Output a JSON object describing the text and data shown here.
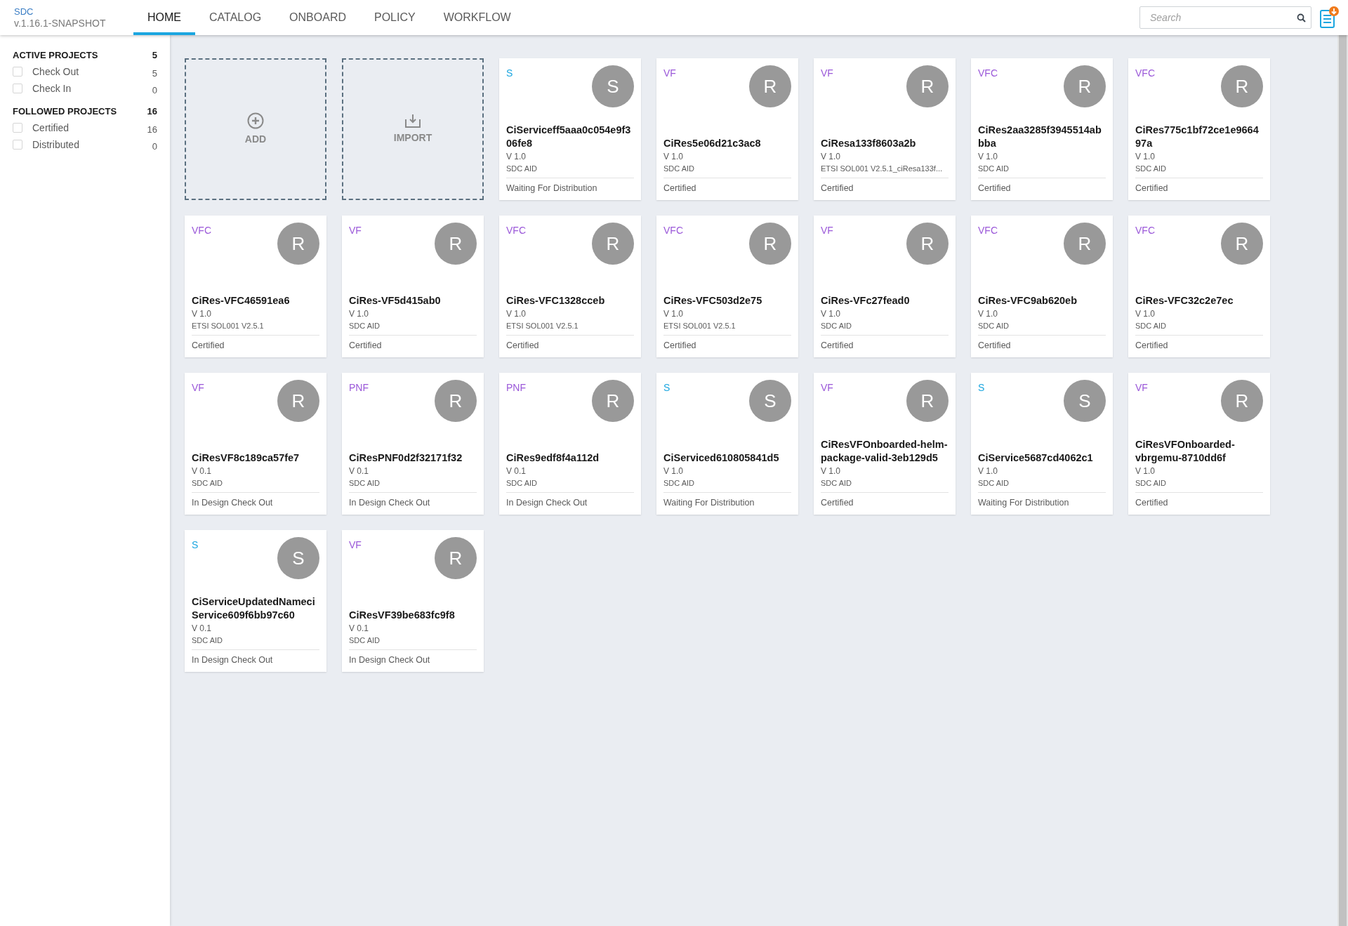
{
  "app": {
    "name": "SDC",
    "version": "v.1.16.1-SNAPSHOT"
  },
  "tabs": [
    {
      "label": "HOME",
      "selected": true
    },
    {
      "label": "CATALOG",
      "selected": false
    },
    {
      "label": "ONBOARD",
      "selected": false
    },
    {
      "label": "POLICY",
      "selected": false
    },
    {
      "label": "WORKFLOW",
      "selected": false
    }
  ],
  "search": {
    "placeholder": "Search"
  },
  "sidebar": {
    "sections": [
      {
        "title": "ACTIVE PROJECTS",
        "count": "5",
        "items": [
          {
            "label": "Check Out",
            "count": "5",
            "checked": false
          },
          {
            "label": "Check In",
            "count": "0",
            "checked": false
          }
        ]
      },
      {
        "title": "FOLLOWED PROJECTS",
        "count": "16",
        "items": [
          {
            "label": "Certified",
            "count": "16",
            "checked": false
          },
          {
            "label": "Distributed",
            "count": "0",
            "checked": false
          }
        ]
      }
    ]
  },
  "actions": [
    {
      "kind": "add",
      "label": "ADD"
    },
    {
      "kind": "import",
      "label": "IMPORT"
    }
  ],
  "cards": [
    {
      "type": "S",
      "color": "#1ba6e0",
      "avatar": "S",
      "name": "CiServiceff5aaa0c054e9f306fe8",
      "version": "V 1.0",
      "vendor": "SDC AID",
      "status": "Waiting For Distribution"
    },
    {
      "type": "VF",
      "color": "#9b59d9",
      "avatar": "R",
      "name": "CiRes5e06d21c3ac8",
      "version": "V 1.0",
      "vendor": "SDC AID",
      "status": "Certified"
    },
    {
      "type": "VF",
      "color": "#9b59d9",
      "avatar": "R",
      "name": "CiResa133f8603a2b",
      "version": "V 1.0",
      "vendor": "ETSI SOL001 V2.5.1_ciResa133f...",
      "status": "Certified"
    },
    {
      "type": "VFC",
      "color": "#9b59d9",
      "avatar": "R",
      "name": "CiRes2aa3285f3945514abbba",
      "version": "V 1.0",
      "vendor": "SDC AID",
      "status": "Certified"
    },
    {
      "type": "VFC",
      "color": "#9b59d9",
      "avatar": "R",
      "name": "CiRes775c1bf72ce1e966497a",
      "version": "V 1.0",
      "vendor": "SDC AID",
      "status": "Certified"
    },
    {
      "type": "VFC",
      "color": "#9b59d9",
      "avatar": "R",
      "name": "CiRes-VFC46591ea6",
      "version": "V 1.0",
      "vendor": "ETSI SOL001 V2.5.1",
      "status": "Certified"
    },
    {
      "type": "VF",
      "color": "#9b59d9",
      "avatar": "R",
      "name": "CiRes-VF5d415ab0",
      "version": "V 1.0",
      "vendor": "SDC AID",
      "status": "Certified"
    },
    {
      "type": "VFC",
      "color": "#9b59d9",
      "avatar": "R",
      "name": "CiRes-VFC1328cceb",
      "version": "V 1.0",
      "vendor": "ETSI SOL001 V2.5.1",
      "status": "Certified"
    },
    {
      "type": "VFC",
      "color": "#9b59d9",
      "avatar": "R",
      "name": "CiRes-VFC503d2e75",
      "version": "V 1.0",
      "vendor": "ETSI SOL001 V2.5.1",
      "status": "Certified"
    },
    {
      "type": "VF",
      "color": "#9b59d9",
      "avatar": "R",
      "name": "CiRes-VFc27fead0",
      "version": "V 1.0",
      "vendor": "SDC AID",
      "status": "Certified"
    },
    {
      "type": "VFC",
      "color": "#9b59d9",
      "avatar": "R",
      "name": "CiRes-VFC9ab620eb",
      "version": "V 1.0",
      "vendor": "SDC AID",
      "status": "Certified"
    },
    {
      "type": "VFC",
      "color": "#9b59d9",
      "avatar": "R",
      "name": "CiRes-VFC32c2e7ec",
      "version": "V 1.0",
      "vendor": "SDC AID",
      "status": "Certified"
    },
    {
      "type": "VF",
      "color": "#9b59d9",
      "avatar": "R",
      "name": "CiResVF8c189ca57fe7",
      "version": "V 0.1",
      "vendor": "SDC AID",
      "status": "In Design Check Out"
    },
    {
      "type": "PNF",
      "color": "#9b59d9",
      "avatar": "R",
      "name": "CiResPNF0d2f32171f32",
      "version": "V 0.1",
      "vendor": "SDC AID",
      "status": "In Design Check Out"
    },
    {
      "type": "PNF",
      "color": "#9b59d9",
      "avatar": "R",
      "name": "CiRes9edf8f4a112d",
      "version": "V 0.1",
      "vendor": "SDC AID",
      "status": "In Design Check Out"
    },
    {
      "type": "S",
      "color": "#1ba6e0",
      "avatar": "S",
      "name": "CiServiced610805841d5",
      "version": "V 1.0",
      "vendor": "SDC AID",
      "status": "Waiting For Distribution"
    },
    {
      "type": "VF",
      "color": "#9b59d9",
      "avatar": "R",
      "name": "CiResVFOnboarded-helm-package-valid-3eb129d5",
      "version": "V 1.0",
      "vendor": "SDC AID",
      "status": "Certified"
    },
    {
      "type": "S",
      "color": "#1ba6e0",
      "avatar": "S",
      "name": "CiService5687cd4062c1",
      "version": "V 1.0",
      "vendor": "SDC AID",
      "status": "Waiting For Distribution"
    },
    {
      "type": "VF",
      "color": "#9b59d9",
      "avatar": "R",
      "name": "CiResVFOnboarded-vbrgemu-8710dd6f",
      "version": "V 1.0",
      "vendor": "SDC AID",
      "status": "Certified"
    },
    {
      "type": "S",
      "color": "#1ba6e0",
      "avatar": "S",
      "name": "CiServiceUpdatedNameciService609f6bb97c60",
      "version": "V 0.1",
      "vendor": "SDC AID",
      "status": "In Design Check Out"
    },
    {
      "type": "VF",
      "color": "#9b59d9",
      "avatar": "R",
      "name": "CiResVF39be683fc9f8",
      "version": "V 0.1",
      "vendor": "SDC AID",
      "status": "In Design Check Out"
    }
  ]
}
